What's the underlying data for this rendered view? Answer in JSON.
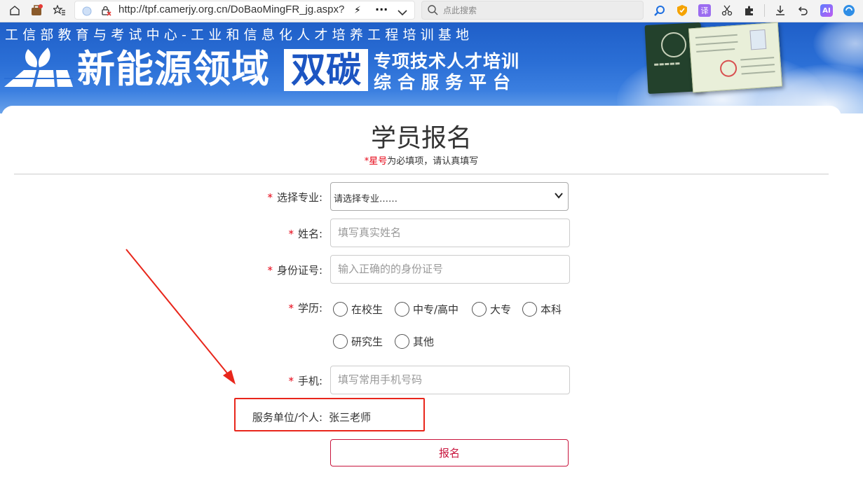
{
  "browser": {
    "url": "http://tpf.camerjy.org.cn/DoBaoMingFR_jg.aspx?",
    "search_placeholder": "点此搜索",
    "translate_label": "译",
    "ai_label": "AI"
  },
  "banner": {
    "tagline": "工信部教育与考试中心-工业和信息化人才培养工程培训基地",
    "title_main": "新能源领域",
    "title_highlight": "双碳",
    "subtitle_line1": "专项技术人才培训",
    "subtitle_line2": "综合服务平台"
  },
  "form": {
    "title": "学员报名",
    "note_red": "*星号",
    "note_rest": "为必填项，请认真填写",
    "major": {
      "label": "选择专业:",
      "selected": "请选择专业……"
    },
    "name": {
      "label": "姓名:",
      "placeholder": "填写真实姓名"
    },
    "id_number": {
      "label": "身份证号:",
      "placeholder": "输入正确的的身份证号"
    },
    "education": {
      "label": "学历:",
      "options": [
        "在校生",
        "中专/高中",
        "大专",
        "本科",
        "研究生",
        "其他"
      ]
    },
    "phone": {
      "label": "手机:",
      "placeholder": "填写常用手机号码"
    },
    "service": {
      "label": "服务单位/个人:",
      "value": "张三老师"
    },
    "submit_label": "报名"
  },
  "colors": {
    "required_star": "#e60012",
    "submit_border": "#c8143c",
    "annotation": "#e8261b",
    "banner_blue": "#2b6fd6"
  }
}
